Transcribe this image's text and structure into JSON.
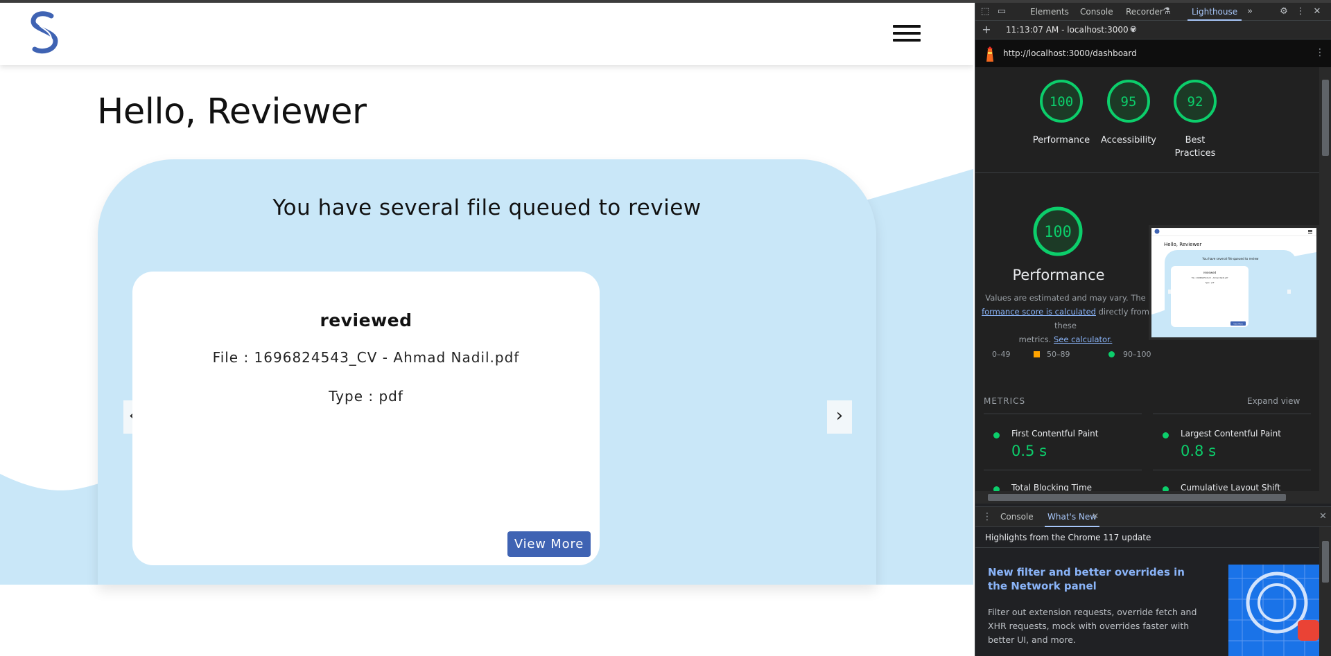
{
  "app": {
    "greeting": "Hello, Reviewer",
    "panel_title": "You have several file queued to review",
    "card": {
      "status": "reviewed",
      "file_line": "File : 1696824543_CV - Ahmad Nadil.pdf",
      "type_line": "Type : pdf",
      "view_more_label": "View More"
    },
    "prev_arrow": "‹",
    "next_arrow": "›",
    "brand_color": "#3f63b3",
    "panel_color": "#c9e7f8"
  },
  "devtools": {
    "tabs": [
      "Elements",
      "Console",
      "Recorder",
      "Lighthouse"
    ],
    "active_tab": "Lighthouse",
    "overflow_label": "»",
    "report_selector": "11:13:07 AM - localhost:3000 ▾",
    "url": "http://localhost:3000/dashboard",
    "scores": [
      {
        "value": 100,
        "label": "Performance"
      },
      {
        "value": 95,
        "label": "Accessibility"
      },
      {
        "value": 92,
        "label": "Best Practices"
      }
    ],
    "performance": {
      "score": 100,
      "title": "Performance",
      "desc_prefix": "Values are estimated and may vary. The",
      "desc_link": "formance score is calculated",
      "desc_middle": "directly from these",
      "desc_metrics": "metrics.",
      "desc_link2": "See calculator."
    },
    "legend": [
      "0–49",
      "50–89",
      "90–100"
    ],
    "metrics_header": "METRICS",
    "expand_label": "Expand view",
    "metrics": [
      {
        "name": "First Contentful Paint",
        "value": "0.5 s"
      },
      {
        "name": "Largest Contentful Paint",
        "value": "0.8 s"
      },
      {
        "name": "Total Blocking Time",
        "value": ""
      },
      {
        "name": "Cumulative Layout Shift",
        "value": ""
      }
    ],
    "drawer": {
      "tabs": [
        "Console",
        "What's New"
      ],
      "active_tab": "What's New",
      "highlights": "Highlights from the Chrome 117 update",
      "news_title": "New filter and better overrides in the Network panel",
      "news_body": "Filter out extension requests, override fetch and XHR requests, mock with overrides faster with better UI, and more."
    },
    "thumbnail": {
      "greeting": "Hello, Reviewer",
      "title": "You have several file queued to review",
      "status": "reviewed",
      "file_line": "File : 1696824543_CV - Ahmad Nadil.pdf",
      "type_line": "Type : pdf",
      "button": "View More"
    },
    "colors": {
      "pass": "#0cce6b",
      "average": "#ffa400",
      "fail": "#ff4e42",
      "link": "#8ab4f8"
    }
  }
}
